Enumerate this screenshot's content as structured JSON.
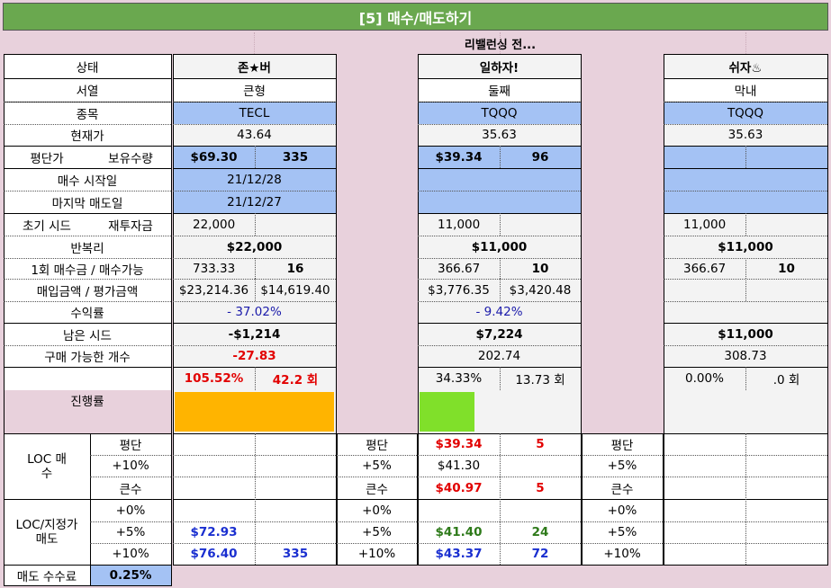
{
  "title": "[5] 매수/매도하기",
  "subtitle": "리밸런싱 전...",
  "labels": {
    "status": "상태",
    "rank": "서열",
    "ticker": "종목",
    "price": "현재가",
    "avg_price": "평단가",
    "holding_qty": "보유수량",
    "buy_start": "매수 시작일",
    "last_sell": "마지막 매도일",
    "init_seed": "초기 시드",
    "reinvest": "재투자금",
    "compound": "반복리",
    "per_buy": "1회 매수금 / 매수가능",
    "buy_eval": "매입금액 / 평가금액",
    "return": "수익률",
    "remain_seed": "남은 시드",
    "buyable": "구매 가능한 개수",
    "progress": "진행률",
    "loc_buy": "LOC 매수",
    "loc_sell": "LOC/지정가 매도",
    "sell_fee": "매도 수수료",
    "fee_value": "0.25%"
  },
  "accounts": [
    {
      "name": "존★버",
      "rank": "큰형",
      "ticker": "TECL",
      "price": "43.64",
      "avg_price": "$69.30",
      "qty": "335",
      "buy_start": "21/12/28",
      "last_sell": "21/12/27",
      "init_seed": "22,000",
      "reinvest": "",
      "compound": "$22,000",
      "per_buy": "733.33",
      "per_buy_qty": "16",
      "buy_amt": "$23,214.36",
      "eval_amt": "$14,619.40",
      "return": "- 37.02%",
      "remain_seed": "-$1,214",
      "buyable": "-27.83",
      "progress_pct": "105.52%",
      "progress_count": "42.2 회",
      "progress_value": 1.0,
      "progress_color": "#ffb400",
      "loc_buy": [
        {
          "label": "평단",
          "price": "",
          "qty": ""
        },
        {
          "label": "+10%",
          "price": "",
          "qty": ""
        },
        {
          "label": "큰수",
          "price": "",
          "qty": ""
        }
      ],
      "loc_sell": [
        {
          "label": "+0%",
          "price": "",
          "qty": ""
        },
        {
          "label": "+5%",
          "price": "$72.93",
          "qty": ""
        },
        {
          "label": "+10%",
          "price": "$76.40",
          "qty": "335"
        }
      ]
    },
    {
      "name": "일하자!",
      "rank": "둘째",
      "ticker": "TQQQ",
      "price": "35.63",
      "avg_price": "$39.34",
      "qty": "96",
      "buy_start": "",
      "last_sell": "",
      "init_seed": "11,000",
      "reinvest": "",
      "compound": "$11,000",
      "per_buy": "366.67",
      "per_buy_qty": "10",
      "buy_amt": "$3,776.35",
      "eval_amt": "$3,420.48",
      "return": "- 9.42%",
      "remain_seed": "$7,224",
      "buyable": "202.74",
      "progress_pct": "34.33%",
      "progress_count": "13.73 회",
      "progress_value": 0.3433,
      "progress_color": "#80e02a",
      "loc_buy": [
        {
          "label": "평단",
          "price": "$39.34",
          "qty": "5"
        },
        {
          "label": "+5%",
          "price": "$41.30",
          "qty": ""
        },
        {
          "label": "큰수",
          "price": "$40.97",
          "qty": "5"
        }
      ],
      "loc_sell": [
        {
          "label": "+0%",
          "price": "",
          "qty": ""
        },
        {
          "label": "+5%",
          "price": "$41.40",
          "qty": "24"
        },
        {
          "label": "+10%",
          "price": "$43.37",
          "qty": "72"
        }
      ]
    },
    {
      "name": "쉬자♨",
      "rank": "막내",
      "ticker": "TQQQ",
      "price": "35.63",
      "avg_price": "",
      "qty": "",
      "buy_start": "",
      "last_sell": "",
      "init_seed": "11,000",
      "reinvest": "",
      "compound": "$11,000",
      "per_buy": "366.67",
      "per_buy_qty": "10",
      "buy_amt": "",
      "eval_amt": "",
      "return": "",
      "remain_seed": "$11,000",
      "buyable": "308.73",
      "progress_pct": "0.00%",
      "progress_count": ".0 회",
      "progress_value": 0,
      "progress_color": "#80e02a",
      "loc_buy": [
        {
          "label": "평단",
          "price": "",
          "qty": ""
        },
        {
          "label": "+5%",
          "price": "",
          "qty": ""
        },
        {
          "label": "큰수",
          "price": "",
          "qty": ""
        }
      ],
      "loc_sell": [
        {
          "label": "+0%",
          "price": "",
          "qty": ""
        },
        {
          "label": "+5%",
          "price": "",
          "qty": ""
        },
        {
          "label": "+10%",
          "price": "",
          "qty": ""
        }
      ]
    }
  ],
  "colors": {
    "header_green": "#6aa84f",
    "pink_bg": "#e8d1dc",
    "blue_cell": "#a4c2f4",
    "light_gray": "#f3f3f3"
  }
}
